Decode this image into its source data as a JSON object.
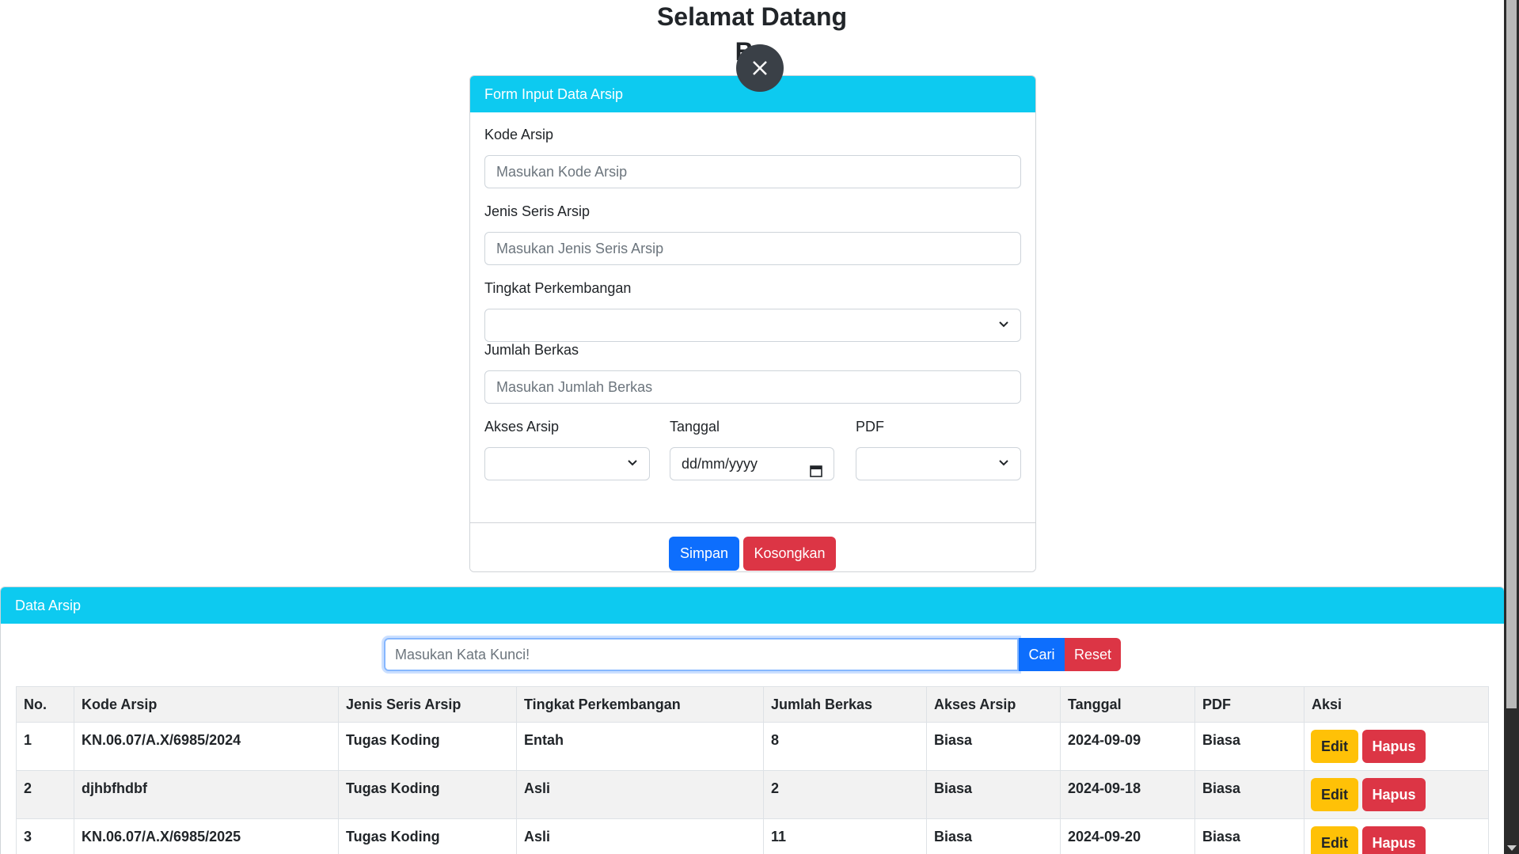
{
  "welcome": {
    "title": "Selamat Datang",
    "subtitle": "Bu"
  },
  "close_icon": "close-icon",
  "form": {
    "header": "Form Input Data Arsip",
    "kode_label": "Kode Arsip",
    "kode_placeholder": "Masukan Kode Arsip",
    "jenis_label": "Jenis Seris Arsip",
    "jenis_placeholder": "Masukan Jenis Seris Arsip",
    "tingkat_label": "Tingkat Perkembangan",
    "jumlah_label": "Jumlah Berkas",
    "jumlah_placeholder": "Masukan Jumlah Berkas",
    "akses_label": "Akses Arsip",
    "tanggal_label": "Tanggal",
    "tanggal_value": "dd/mm/yyyy",
    "pdf_label": "PDF",
    "simpan_label": "Simpan",
    "kosongkan_label": "Kosongkan"
  },
  "data_section": {
    "header": "Data Arsip",
    "search_placeholder": "Masukan Kata Kunci!",
    "cari_label": "Cari",
    "reset_label": "Reset",
    "columns": [
      "No.",
      "Kode Arsip",
      "Jenis Seris Arsip",
      "Tingkat Perkembangan",
      "Jumlah Berkas",
      "Akses Arsip",
      "Tanggal",
      "PDF",
      "Aksi"
    ],
    "rows": [
      [
        "1",
        "KN.06.07/A.X/6985/2024",
        "Tugas Koding",
        "Entah",
        "8",
        "Biasa",
        "2024-09-09",
        "Biasa"
      ],
      [
        "2",
        "djhbfhdbf",
        "Tugas Koding",
        "Asli",
        "2",
        "Biasa",
        "2024-09-18",
        "Biasa"
      ],
      [
        "3",
        "KN.06.07/A.X/6985/2025",
        "Tugas Koding",
        "Asli",
        "11",
        "Biasa",
        "2024-09-20",
        "Biasa"
      ]
    ],
    "edit_label": "Edit",
    "hapus_label": "Hapus"
  },
  "colors": {
    "info": "#0dcaf0",
    "primary": "#0d6efd",
    "danger": "#dc3545",
    "warning": "#ffc107"
  }
}
